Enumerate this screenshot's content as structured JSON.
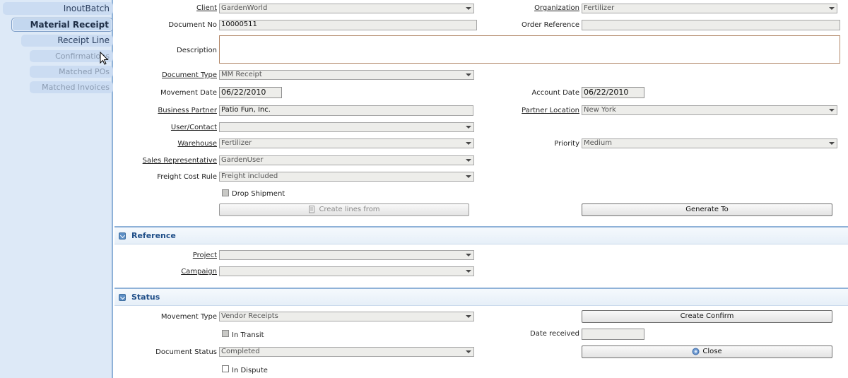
{
  "sidebar": {
    "tabs": [
      {
        "label": "InoutBatch",
        "state": "normal"
      },
      {
        "label": "Material Receipt",
        "state": "active"
      },
      {
        "label": "Receipt Line",
        "state": "normal"
      },
      {
        "label": "Confirmations",
        "state": "disabled"
      },
      {
        "label": "Matched POs",
        "state": "disabled"
      },
      {
        "label": "Matched Invoices",
        "state": "disabled"
      }
    ]
  },
  "form": {
    "client": {
      "label": "Client",
      "value": "GardenWorld"
    },
    "organization": {
      "label": "Organization",
      "value": "Fertilizer"
    },
    "document_no": {
      "label": "Document No",
      "value": "10000511"
    },
    "order_reference": {
      "label": "Order Reference",
      "value": ""
    },
    "description": {
      "label": "Description",
      "value": ""
    },
    "document_type": {
      "label": "Document Type",
      "value": "MM Receipt"
    },
    "movement_date": {
      "label": "Movement Date",
      "value": "06/22/2010"
    },
    "account_date": {
      "label": "Account Date",
      "value": "06/22/2010"
    },
    "business_partner": {
      "label": "Business Partner",
      "value": "Patio Fun, Inc."
    },
    "partner_location": {
      "label": "Partner Location",
      "value": "New York"
    },
    "user_contact": {
      "label": "User/Contact",
      "value": ""
    },
    "warehouse": {
      "label": "Warehouse",
      "value": "Fertilizer"
    },
    "priority": {
      "label": "Priority",
      "value": "Medium"
    },
    "sales_rep": {
      "label": "Sales Representative",
      "value": "GardenUser"
    },
    "freight_cost_rule": {
      "label": "Freight Cost Rule",
      "value": "Freight included"
    },
    "drop_shipment": {
      "label": "Drop Shipment",
      "checked": false
    },
    "create_lines_from": {
      "label": "Create lines from"
    },
    "generate_to": {
      "label": "Generate To"
    }
  },
  "reference": {
    "title": "Reference",
    "project": {
      "label": "Project",
      "value": ""
    },
    "campaign": {
      "label": "Campaign",
      "value": ""
    }
  },
  "status": {
    "title": "Status",
    "movement_type": {
      "label": "Movement Type",
      "value": "Vendor Receipts"
    },
    "create_confirm": {
      "label": "Create Confirm"
    },
    "in_transit": {
      "label": "In Transit",
      "checked": false
    },
    "date_received": {
      "label": "Date received",
      "value": ""
    },
    "document_status": {
      "label": "Document Status",
      "value": "Completed"
    },
    "close": {
      "label": "Close"
    },
    "in_dispute": {
      "label": "In Dispute",
      "checked": false
    }
  },
  "colors": {
    "sidebar_bg": "#dde9f7",
    "accent": "#1f4e88",
    "field_bg": "#ededea"
  }
}
